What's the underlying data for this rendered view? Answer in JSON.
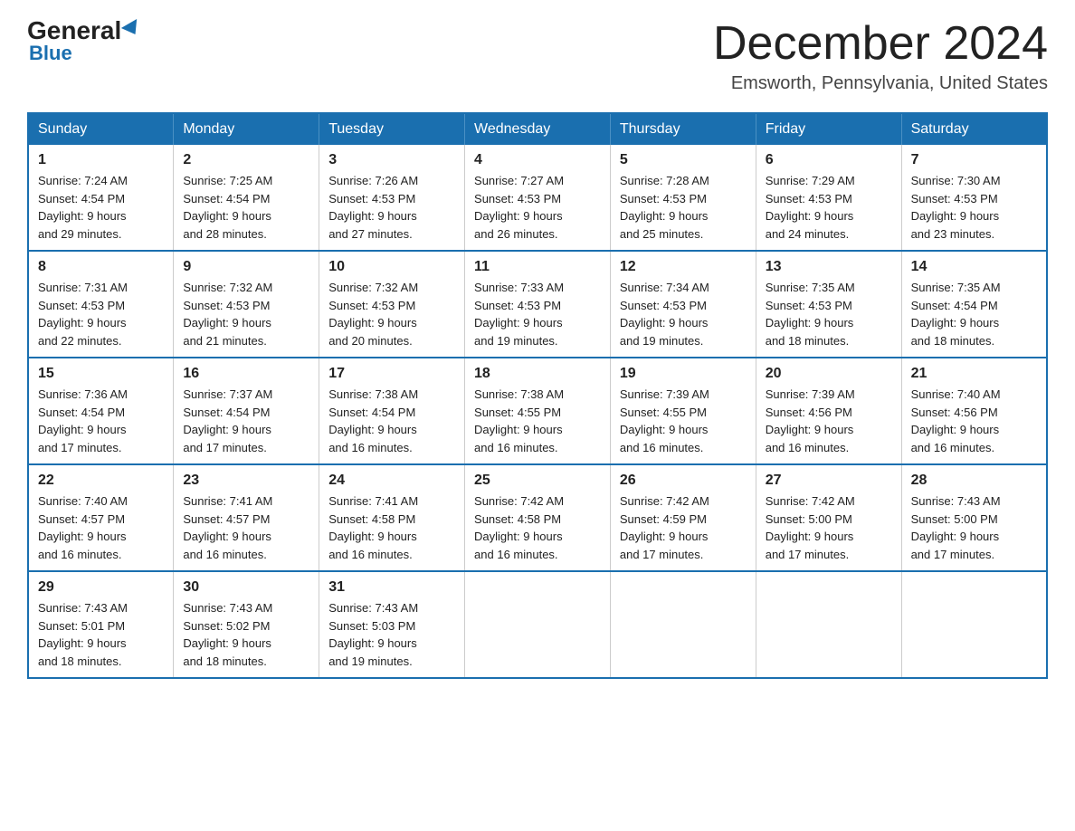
{
  "logo": {
    "general": "General",
    "blue": "Blue",
    "triangle_symbol": "▶"
  },
  "header": {
    "month_year": "December 2024",
    "location": "Emsworth, Pennsylvania, United States"
  },
  "days_of_week": [
    "Sunday",
    "Monday",
    "Tuesday",
    "Wednesday",
    "Thursday",
    "Friday",
    "Saturday"
  ],
  "weeks": [
    [
      {
        "day": "1",
        "sunrise": "7:24 AM",
        "sunset": "4:54 PM",
        "daylight": "9 hours and 29 minutes."
      },
      {
        "day": "2",
        "sunrise": "7:25 AM",
        "sunset": "4:54 PM",
        "daylight": "9 hours and 28 minutes."
      },
      {
        "day": "3",
        "sunrise": "7:26 AM",
        "sunset": "4:53 PM",
        "daylight": "9 hours and 27 minutes."
      },
      {
        "day": "4",
        "sunrise": "7:27 AM",
        "sunset": "4:53 PM",
        "daylight": "9 hours and 26 minutes."
      },
      {
        "day": "5",
        "sunrise": "7:28 AM",
        "sunset": "4:53 PM",
        "daylight": "9 hours and 25 minutes."
      },
      {
        "day": "6",
        "sunrise": "7:29 AM",
        "sunset": "4:53 PM",
        "daylight": "9 hours and 24 minutes."
      },
      {
        "day": "7",
        "sunrise": "7:30 AM",
        "sunset": "4:53 PM",
        "daylight": "9 hours and 23 minutes."
      }
    ],
    [
      {
        "day": "8",
        "sunrise": "7:31 AM",
        "sunset": "4:53 PM",
        "daylight": "9 hours and 22 minutes."
      },
      {
        "day": "9",
        "sunrise": "7:32 AM",
        "sunset": "4:53 PM",
        "daylight": "9 hours and 21 minutes."
      },
      {
        "day": "10",
        "sunrise": "7:32 AM",
        "sunset": "4:53 PM",
        "daylight": "9 hours and 20 minutes."
      },
      {
        "day": "11",
        "sunrise": "7:33 AM",
        "sunset": "4:53 PM",
        "daylight": "9 hours and 19 minutes."
      },
      {
        "day": "12",
        "sunrise": "7:34 AM",
        "sunset": "4:53 PM",
        "daylight": "9 hours and 19 minutes."
      },
      {
        "day": "13",
        "sunrise": "7:35 AM",
        "sunset": "4:53 PM",
        "daylight": "9 hours and 18 minutes."
      },
      {
        "day": "14",
        "sunrise": "7:35 AM",
        "sunset": "4:54 PM",
        "daylight": "9 hours and 18 minutes."
      }
    ],
    [
      {
        "day": "15",
        "sunrise": "7:36 AM",
        "sunset": "4:54 PM",
        "daylight": "9 hours and 17 minutes."
      },
      {
        "day": "16",
        "sunrise": "7:37 AM",
        "sunset": "4:54 PM",
        "daylight": "9 hours and 17 minutes."
      },
      {
        "day": "17",
        "sunrise": "7:38 AM",
        "sunset": "4:54 PM",
        "daylight": "9 hours and 16 minutes."
      },
      {
        "day": "18",
        "sunrise": "7:38 AM",
        "sunset": "4:55 PM",
        "daylight": "9 hours and 16 minutes."
      },
      {
        "day": "19",
        "sunrise": "7:39 AM",
        "sunset": "4:55 PM",
        "daylight": "9 hours and 16 minutes."
      },
      {
        "day": "20",
        "sunrise": "7:39 AM",
        "sunset": "4:56 PM",
        "daylight": "9 hours and 16 minutes."
      },
      {
        "day": "21",
        "sunrise": "7:40 AM",
        "sunset": "4:56 PM",
        "daylight": "9 hours and 16 minutes."
      }
    ],
    [
      {
        "day": "22",
        "sunrise": "7:40 AM",
        "sunset": "4:57 PM",
        "daylight": "9 hours and 16 minutes."
      },
      {
        "day": "23",
        "sunrise": "7:41 AM",
        "sunset": "4:57 PM",
        "daylight": "9 hours and 16 minutes."
      },
      {
        "day": "24",
        "sunrise": "7:41 AM",
        "sunset": "4:58 PM",
        "daylight": "9 hours and 16 minutes."
      },
      {
        "day": "25",
        "sunrise": "7:42 AM",
        "sunset": "4:58 PM",
        "daylight": "9 hours and 16 minutes."
      },
      {
        "day": "26",
        "sunrise": "7:42 AM",
        "sunset": "4:59 PM",
        "daylight": "9 hours and 17 minutes."
      },
      {
        "day": "27",
        "sunrise": "7:42 AM",
        "sunset": "5:00 PM",
        "daylight": "9 hours and 17 minutes."
      },
      {
        "day": "28",
        "sunrise": "7:43 AM",
        "sunset": "5:00 PM",
        "daylight": "9 hours and 17 minutes."
      }
    ],
    [
      {
        "day": "29",
        "sunrise": "7:43 AM",
        "sunset": "5:01 PM",
        "daylight": "9 hours and 18 minutes."
      },
      {
        "day": "30",
        "sunrise": "7:43 AM",
        "sunset": "5:02 PM",
        "daylight": "9 hours and 18 minutes."
      },
      {
        "day": "31",
        "sunrise": "7:43 AM",
        "sunset": "5:03 PM",
        "daylight": "9 hours and 19 minutes."
      },
      null,
      null,
      null,
      null
    ]
  ],
  "labels": {
    "sunrise": "Sunrise:",
    "sunset": "Sunset:",
    "daylight": "Daylight:"
  }
}
